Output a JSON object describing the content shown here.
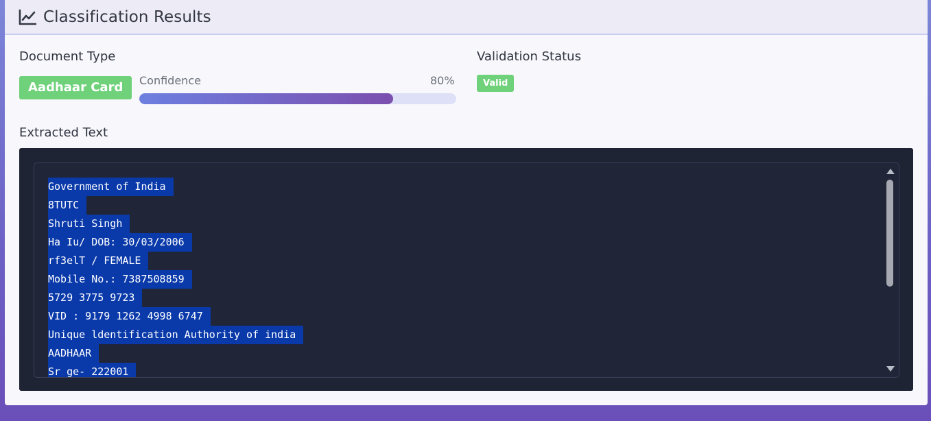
{
  "header": {
    "title": "Classification Results",
    "icon": "line-chart-icon"
  },
  "document_type": {
    "label": "Document Type",
    "value": "Aadhaar Card",
    "badge_color": "#6fd17a"
  },
  "confidence": {
    "label": "Confidence",
    "value_text": "80%",
    "value": 0.8
  },
  "validation": {
    "label": "Validation Status",
    "value": "Valid",
    "badge_color": "#6fd17a"
  },
  "extracted": {
    "label": "Extracted Text",
    "lines": [
      "Government of India",
      "8TUTC",
      "Shruti Singh",
      "Ha Iu/ DOB: 30/03/2006",
      "rf3elT / FEMALE",
      "Mobile No.: 7387508859",
      "5729 3775 9723",
      "VID : 9179 1262 4998 6747",
      "Unique ldentification Authority of india",
      "AADHAAR",
      "Sr ge- 222001"
    ]
  }
}
